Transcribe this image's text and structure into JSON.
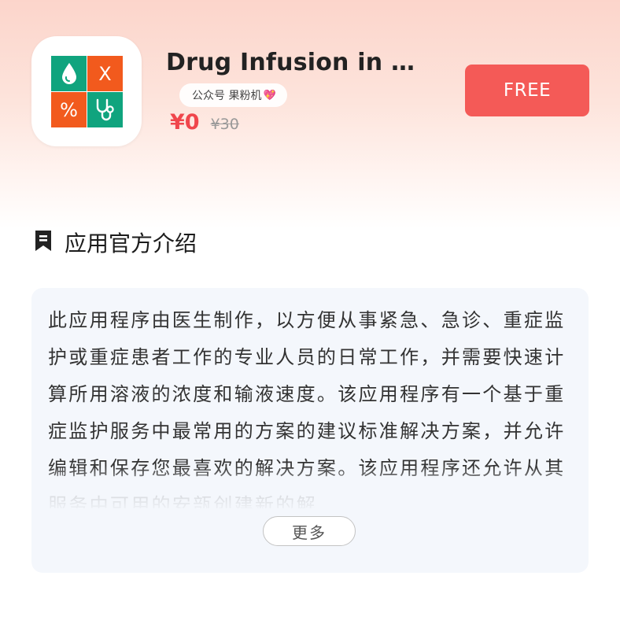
{
  "app": {
    "name": "Drug Infusion in U...",
    "price_now": "¥0",
    "price_old": "¥30",
    "get_button_label": "FREE"
  },
  "watermark": {
    "text": "公众号 果粉机",
    "emoji": "💖"
  },
  "icon_tiles": {
    "multiply_glyph": "X",
    "percent_glyph": "%"
  },
  "description": {
    "section_title": "应用官方介绍",
    "text": "此应用程序由医生制作，以方便从事紧急、急诊、重症监护或重症患者工作的专业人员的日常工作，并需要快速计算所用溶液的浓度和输液速度。该应用程序有一个基于重症监护服务中最常用的方案的建议标准解决方案，并允许编辑和保存您最喜欢的解决方案。该应用程序还允许从其服务中可用的安瓿创建新的解",
    "more_label": "更多"
  },
  "colors": {
    "accent_red": "#f45a57",
    "price_red": "#f0464c",
    "tile_green": "#10a47e",
    "tile_orange": "#f25a1d",
    "card_bg": "#f4f7fc"
  },
  "icons": {
    "app_icon_tiles": [
      "drop-icon",
      "multiply-icon",
      "percent-icon",
      "stethoscope-icon"
    ],
    "section_icon": "bookmark-icon"
  }
}
